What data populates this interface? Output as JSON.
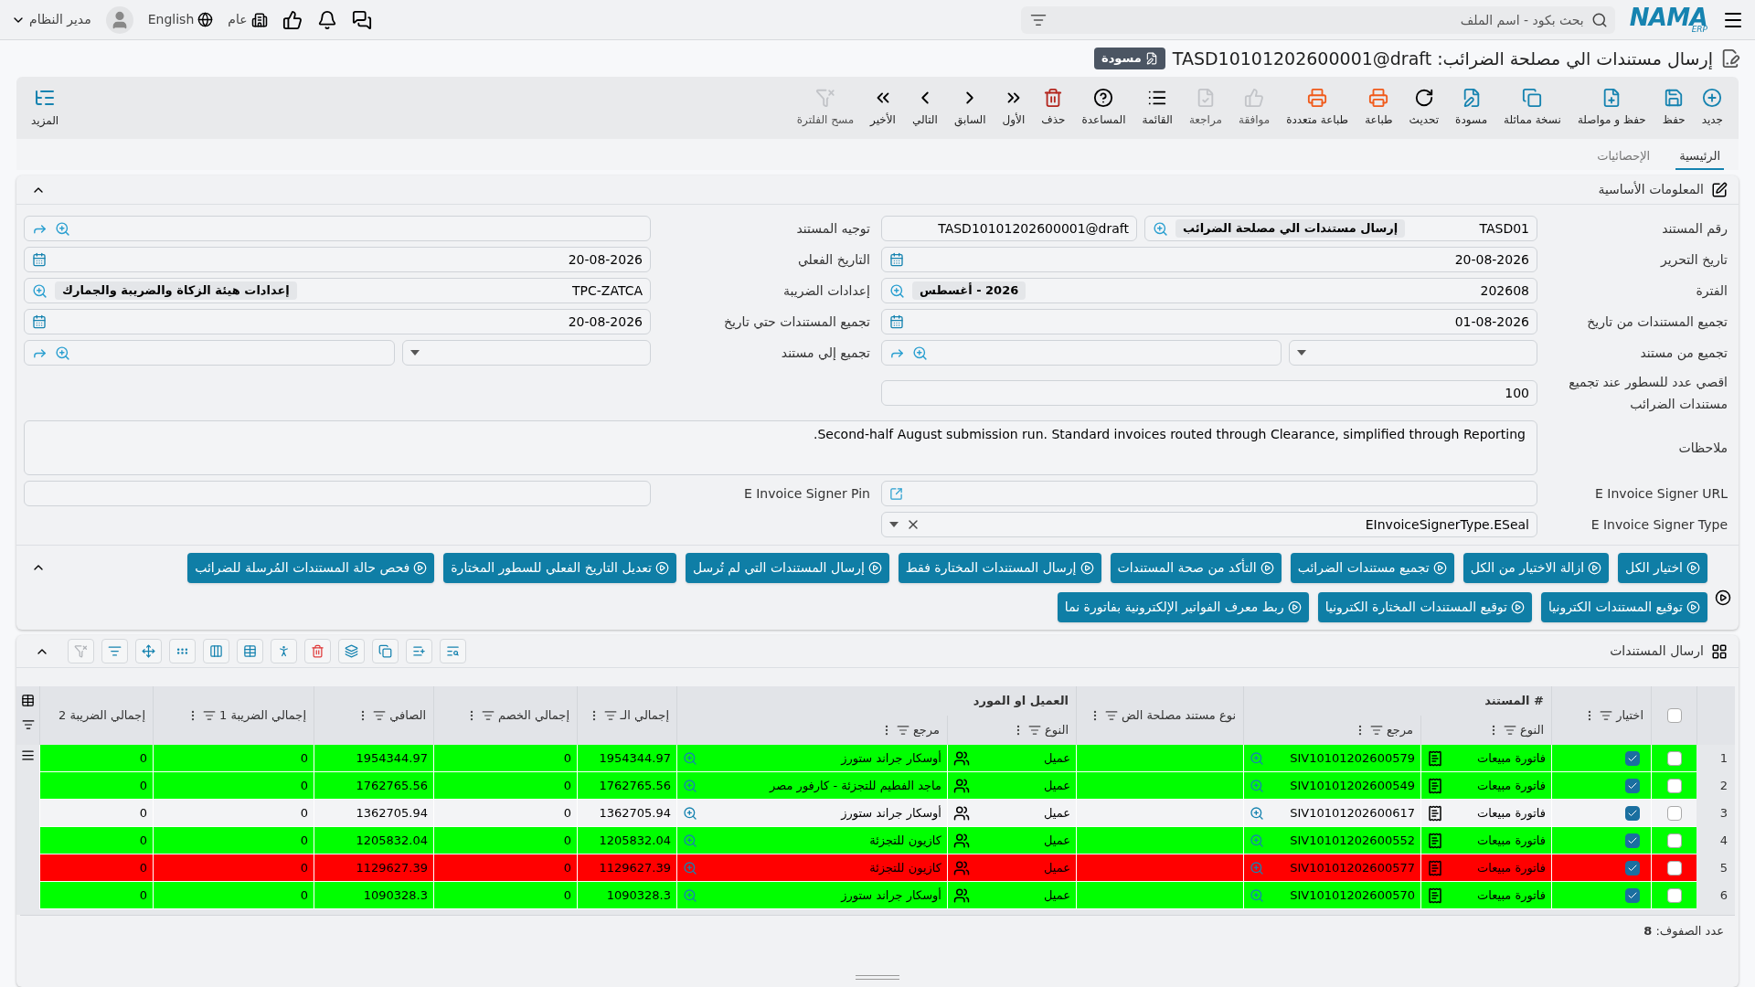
{
  "topbar": {
    "logo": {
      "name": "NAMA",
      "sub": "ERP"
    },
    "search": {
      "placeholder": "بحث بكود - اسم الملف"
    },
    "branch": "عام",
    "language": "English",
    "user": "مدير النظام"
  },
  "title": {
    "text": "إرسال مستندات الي مصلحة الضرائب: TASD10101202600001@draft",
    "status": "مسودة"
  },
  "toolbar": {
    "items": [
      {
        "label": "جديد",
        "disabled": false
      },
      {
        "label": "حفظ",
        "disabled": false
      },
      {
        "label": "حفظ و مواصلة",
        "disabled": false
      },
      {
        "label": "نسخة مماثلة",
        "disabled": false
      },
      {
        "label": "مسودة",
        "disabled": false
      },
      {
        "label": "تحديث",
        "disabled": false
      },
      {
        "label": "طباعة",
        "disabled": false
      },
      {
        "label": "طباعة متعددة",
        "disabled": false
      },
      {
        "label": "موافقة",
        "disabled": true
      },
      {
        "label": "مراجعة",
        "disabled": true
      },
      {
        "label": "القائمة",
        "disabled": false
      },
      {
        "label": "المساعدة",
        "disabled": false
      },
      {
        "label": "حذف",
        "disabled": false
      },
      {
        "label": "الأول",
        "disabled": false
      },
      {
        "label": "السابق",
        "disabled": false
      },
      {
        "label": "التالي",
        "disabled": false
      },
      {
        "label": "الأخير",
        "disabled": false
      },
      {
        "label": "مسح الفلترة",
        "disabled": true
      }
    ],
    "more": "المزيد"
  },
  "tabs": [
    {
      "label": "الرئيسية",
      "selected": true
    },
    {
      "label": "الإحصائيات",
      "selected": false
    }
  ],
  "section": {
    "title": "المعلومات الأساسية",
    "expanded": true
  },
  "form": {
    "rows": [
      {
        "right": {
          "label": "رقم المستند",
          "kind": "lookup",
          "value": "TASD01",
          "tag": "إرسال مستندات الي مصلحة الضرائب",
          "suffix": "TASD10101202600001@draft"
        },
        "left": {
          "label": "توجيه المستند",
          "kind": "lookup",
          "navigable": true
        }
      },
      {
        "right": {
          "label": "تاريخ التحرير",
          "kind": "date",
          "value": "20-08-2026"
        },
        "left": {
          "label": "التاريخ الفعلي",
          "kind": "date",
          "value": "20-08-2026"
        }
      },
      {
        "right": {
          "label": "الفترة",
          "kind": "lookup",
          "value": "202608",
          "tag": "2026 - أغسطس"
        },
        "left": {
          "label": "إعدادات الضريبة",
          "kind": "lookup",
          "value": "TPC-ZATCA",
          "tag": "إعدادات هيئة الزكاة والضريبة والجمارك"
        }
      },
      {
        "right": {
          "label": "تجميع المستندات من تاريخ",
          "kind": "date",
          "value": "01-08-2026"
        },
        "left": {
          "label": "تجميع المستندات حتي تاريخ",
          "kind": "date",
          "value": "20-08-2026"
        }
      },
      {
        "right": {
          "label": "تجميع من مستند",
          "kind": "pair"
        },
        "left": {
          "label": "تجميع إلي مستند",
          "kind": "pair"
        }
      },
      {
        "right": {
          "label": "اقصي عدد للسطور عند تجميع مستندات الضرائب",
          "kind": "text",
          "value": "100"
        }
      }
    ],
    "notes": {
      "label": "ملاحظات",
      "value": "Second-half August submission run. Standard invoices routed through Clearance, simplified through Reporting."
    },
    "signer_rows": [
      {
        "right": {
          "label": "E Invoice Signer URL",
          "kind": "url"
        },
        "left": {
          "label": "E Invoice Signer Pin",
          "kind": "text"
        }
      },
      {
        "right": {
          "label": "E Invoice Signer Type",
          "kind": "select",
          "value": "EInvoiceSignerType.ESeal"
        }
      }
    ]
  },
  "actions": [
    "اختيار الكل",
    "ازالة الاختيار من الكل",
    "تجميع مستندات الضرائب",
    "التأكد من صحة المستندات",
    "إرسال المستندات المختارة فقط",
    "إرسال المستندات التي لم تُرسل",
    "تعديل التاريخ الفعلي للسطور المختارة",
    "فحص حالة المستندات المُرسلة للضرائب",
    "توقيع المستندات الكترونيا",
    "توقيع المستندات المختارة الكترونيا",
    "ربط معرف الفواتير الإلكترونية بفاتورة نما"
  ],
  "grid": {
    "title": "ارسال المستندات",
    "all_selected": false,
    "columns": [
      {
        "label": "اختيار"
      },
      {
        "label": "# المستند",
        "children": [
          {
            "label": "النوع"
          },
          {
            "label": "مرجع"
          }
        ]
      },
      {
        "label": "نوع مستند مصلحة الض"
      },
      {
        "label": "العميل او المورد",
        "children": [
          {
            "label": "النوع"
          },
          {
            "label": "مرجع"
          }
        ]
      },
      {
        "label": "إجمالي الـ"
      },
      {
        "label": "إجمالي الخصم"
      },
      {
        "label": "الصافي"
      },
      {
        "label": "إجمالي الضريبة 1"
      },
      {
        "label": "إجمالي الضريبة 2"
      }
    ],
    "rows": [
      {
        "index": "1",
        "selected": false,
        "picked": true,
        "color": "#00ff00",
        "doc_type": "فاتورة مبيعات",
        "doc_ref": "SIV10101202600579",
        "party_type": "عميل",
        "party_ref": "أوسكار جراند ستورز",
        "total": "1954344.97",
        "discount": "0",
        "net": "1954344.97",
        "tax1": "0",
        "tax2": "0"
      },
      {
        "index": "2",
        "selected": false,
        "picked": true,
        "color": "#00ff00",
        "doc_type": "فاتورة مبيعات",
        "doc_ref": "SIV10101202600549",
        "party_type": "عميل",
        "party_ref": "ماجد الفطيم للتجزئة - كارفور مصر",
        "total": "1762765.56",
        "discount": "0",
        "net": "1762765.56",
        "tax1": "0",
        "tax2": "0"
      },
      {
        "index": "3",
        "selected": false,
        "picked": true,
        "color": "#f3f4f6",
        "doc_type": "فاتورة مبيعات",
        "doc_ref": "SIV10101202600617",
        "party_type": "عميل",
        "party_ref": "أوسكار جراند ستورز",
        "total": "1362705.94",
        "discount": "0",
        "net": "1362705.94",
        "tax1": "0",
        "tax2": "0"
      },
      {
        "index": "4",
        "selected": false,
        "picked": true,
        "color": "#00ff00",
        "doc_type": "فاتورة مبيعات",
        "doc_ref": "SIV10101202600552",
        "party_type": "عميل",
        "party_ref": "كازيون للتجزئة",
        "total": "1205832.04",
        "discount": "0",
        "net": "1205832.04",
        "tax1": "0",
        "tax2": "0"
      },
      {
        "index": "5",
        "selected": false,
        "picked": true,
        "color": "#ff0000",
        "doc_type": "فاتورة مبيعات",
        "doc_ref": "SIV10101202600577",
        "party_type": "عميل",
        "party_ref": "كازيون للتجزئة",
        "total": "1129627.39",
        "discount": "0",
        "net": "1129627.39",
        "tax1": "0",
        "tax2": "0"
      },
      {
        "index": "6",
        "selected": false,
        "picked": true,
        "color": "#00ff00",
        "doc_type": "فاتورة مبيعات",
        "doc_ref": "SIV10101202600570",
        "party_type": "عميل",
        "party_ref": "أوسكار جراند ستورز",
        "total": "1090328.3",
        "discount": "0",
        "net": "1090328.3",
        "tax1": "0",
        "tax2": "0"
      }
    ],
    "footer": "عدد الصفوف: **8**"
  }
}
